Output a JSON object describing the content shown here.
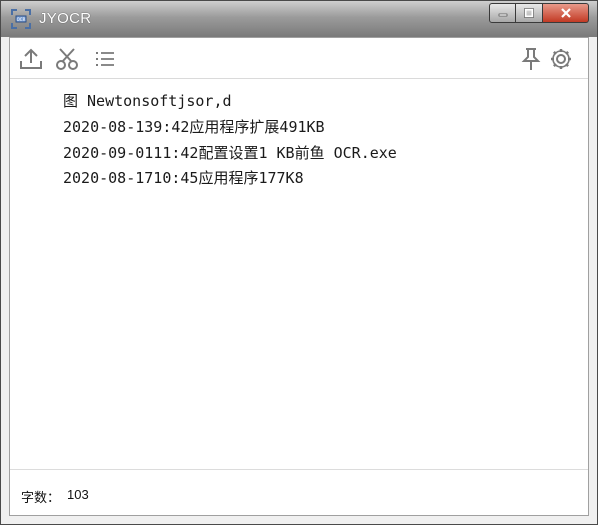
{
  "window": {
    "title": "JYOCR"
  },
  "toolbar": {
    "icons": [
      "upload-icon",
      "scissors-icon",
      "list-icon",
      "pin-icon",
      "gear-icon"
    ]
  },
  "content": {
    "lines": [
      "图 Newtonsoftjsor,d",
      "2020-08-139:42应用程序扩展491KB",
      "2020-09-0111:42配置设置1 KB前鱼 OCR.exe",
      "2020-08-1710:45应用程序177K8"
    ]
  },
  "status": {
    "label": "字数：",
    "value": "103"
  },
  "colors": {
    "titlebar_top": "#cfcfcf",
    "titlebar_bottom": "#7a7a7a",
    "close_button": "#c23a24",
    "icon": "#7a7a7a"
  }
}
